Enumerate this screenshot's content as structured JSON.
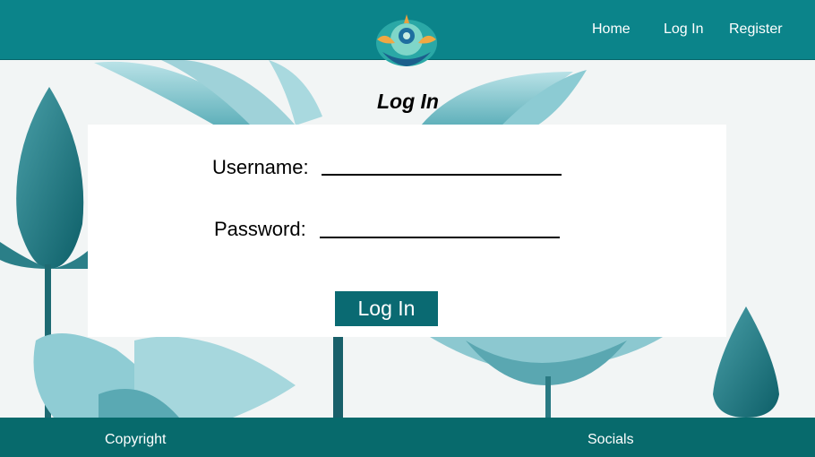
{
  "header": {
    "logo_icon": "lotus-meditation-logo",
    "nav": [
      {
        "label": "Home"
      },
      {
        "label": "Log In"
      },
      {
        "label": "Register"
      }
    ]
  },
  "main": {
    "title": "Log In",
    "form": {
      "username_label": "Username:",
      "username_value": "",
      "password_label": "Password:",
      "password_value": "",
      "submit_label": "Log In"
    }
  },
  "footer": {
    "copyright": "Copyright",
    "socials": "Socials"
  },
  "colors": {
    "header": "#0b848a",
    "footer": "#076a6c",
    "button": "#0a6a72",
    "lotus": "#7cc4cf"
  }
}
